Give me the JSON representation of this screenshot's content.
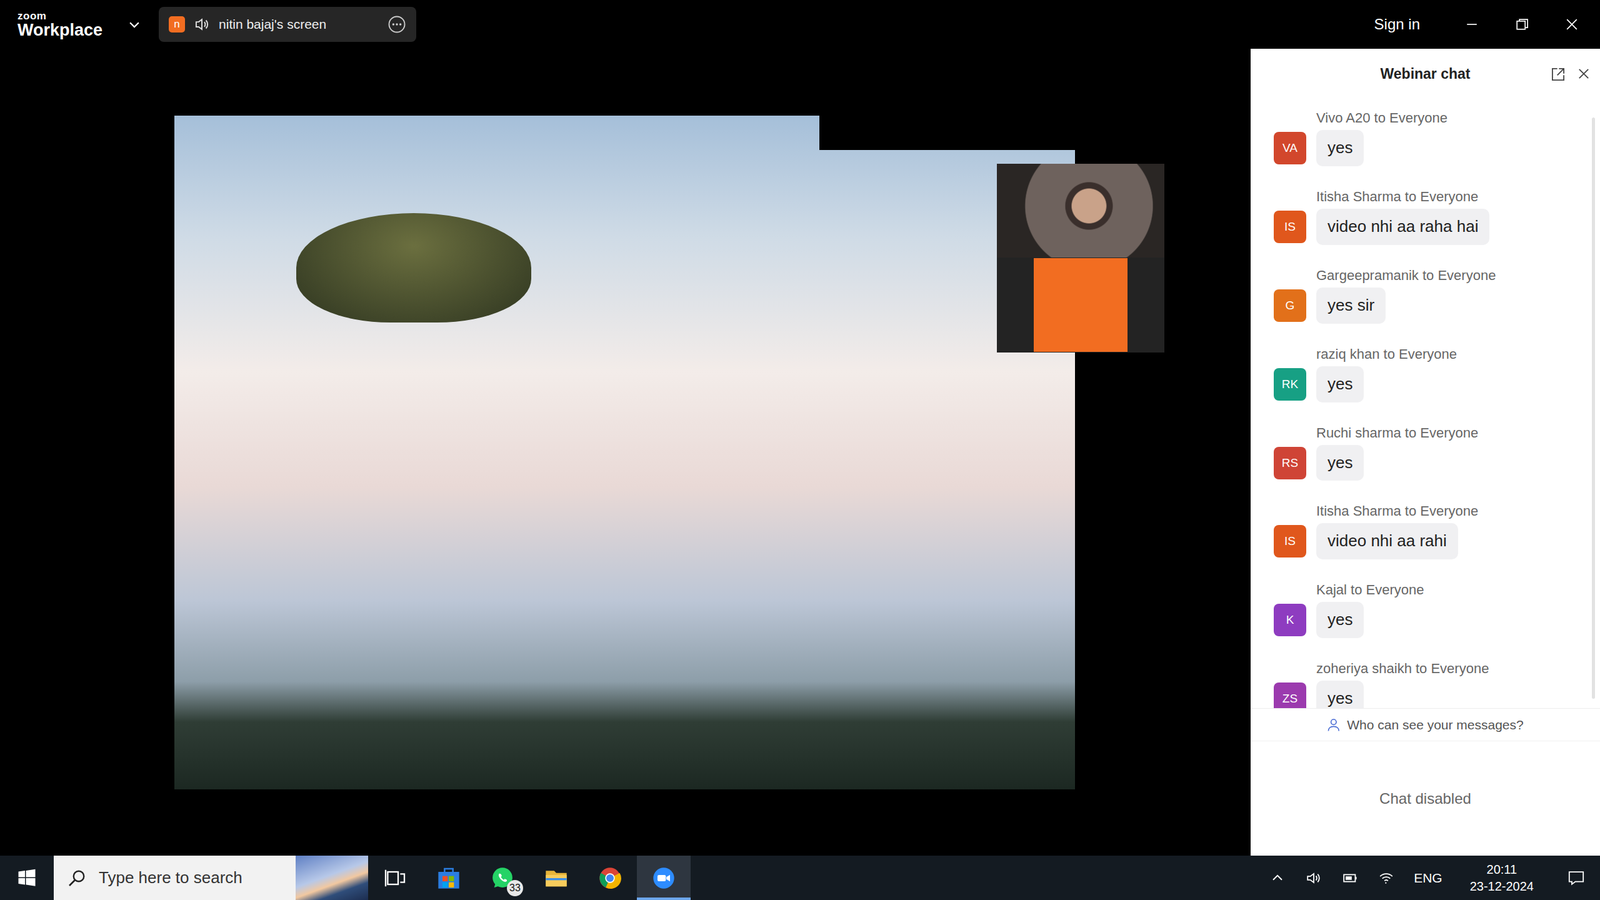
{
  "window": {
    "app_brand": "zoom",
    "app_name": "Workplace",
    "share_avatar": "n",
    "share_label": "nitin bajaj's screen",
    "sign_in": "Sign in"
  },
  "chat": {
    "title": "Webinar chat",
    "messages": [
      {
        "initials": "VA",
        "sender": "Vivo A20 to Everyone",
        "text": "yes",
        "color": "#d2472c"
      },
      {
        "initials": "IS",
        "sender": "Itisha Sharma to Everyone",
        "text": "video nhi aa raha hai",
        "color": "#e0571c"
      },
      {
        "initials": "G",
        "sender": "Gargeepramanik to Everyone",
        "text": "yes sir",
        "color": "#e2701a"
      },
      {
        "initials": "RK",
        "sender": "raziq khan to Everyone",
        "text": "yes",
        "color": "#17a084"
      },
      {
        "initials": "RS",
        "sender": "Ruchi sharma to Everyone",
        "text": "yes",
        "color": "#cf4436"
      },
      {
        "initials": "IS",
        "sender": "Itisha Sharma to Everyone",
        "text": "video nhi aa rahi",
        "color": "#e0571c"
      },
      {
        "initials": "K",
        "sender": "Kajal to Everyone",
        "text": "yes",
        "color": "#8e3cc0"
      },
      {
        "initials": "ZS",
        "sender": "zoheriya shaikh to Everyone",
        "text": "yes",
        "color": "#9b3aae"
      }
    ],
    "visibility_note": "Who can see your messages?",
    "status": "Chat disabled"
  },
  "taskbar": {
    "search_placeholder": "Type here to search",
    "apps": [
      {
        "kind": "taskview",
        "active": false,
        "badge": ""
      },
      {
        "kind": "store",
        "active": false,
        "badge": ""
      },
      {
        "kind": "whatsapp",
        "active": false,
        "badge": "33"
      },
      {
        "kind": "explorer",
        "active": false,
        "badge": ""
      },
      {
        "kind": "chrome",
        "active": false,
        "badge": ""
      },
      {
        "kind": "zoom",
        "active": true,
        "badge": ""
      }
    ],
    "tray": {
      "language": "ENG",
      "time": "20:11",
      "date": "23-12-2024"
    }
  }
}
